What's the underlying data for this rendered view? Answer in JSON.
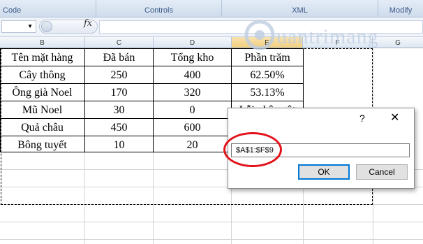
{
  "ribbon": {
    "groups": [
      {
        "label": "Code"
      },
      {
        "label": "Controls"
      },
      {
        "label": "XML"
      },
      {
        "label": "Modify"
      }
    ]
  },
  "formula_bar": {
    "fx_label": "fx",
    "content": ""
  },
  "columns": [
    "B",
    "C",
    "D",
    "E",
    "F",
    "G"
  ],
  "table": {
    "headers": [
      "Tên mặt hàng",
      "Đã bán",
      "Tổng kho",
      "Phần trăm"
    ],
    "rows": [
      [
        "Cây thông",
        "250",
        "400",
        "62.50%"
      ],
      [
        "Ông già Noel",
        "170",
        "320",
        "53.13%"
      ],
      [
        "Mũ Noel",
        "30",
        "0",
        "Lỗi phân cột"
      ],
      [
        "Quả châu",
        "450",
        "600",
        ""
      ],
      [
        "Bông tuyết",
        "10",
        "20",
        ""
      ]
    ]
  },
  "dialog": {
    "help_glyph": "?",
    "close_glyph": "✕",
    "range_value": "$A$1:$F$9",
    "ok_label": "OK",
    "cancel_label": "Cancel"
  },
  "watermark": {
    "text": "uantrimang"
  },
  "colors": {
    "annotation_red": "#e3131b",
    "ok_border": "#0078d7"
  }
}
